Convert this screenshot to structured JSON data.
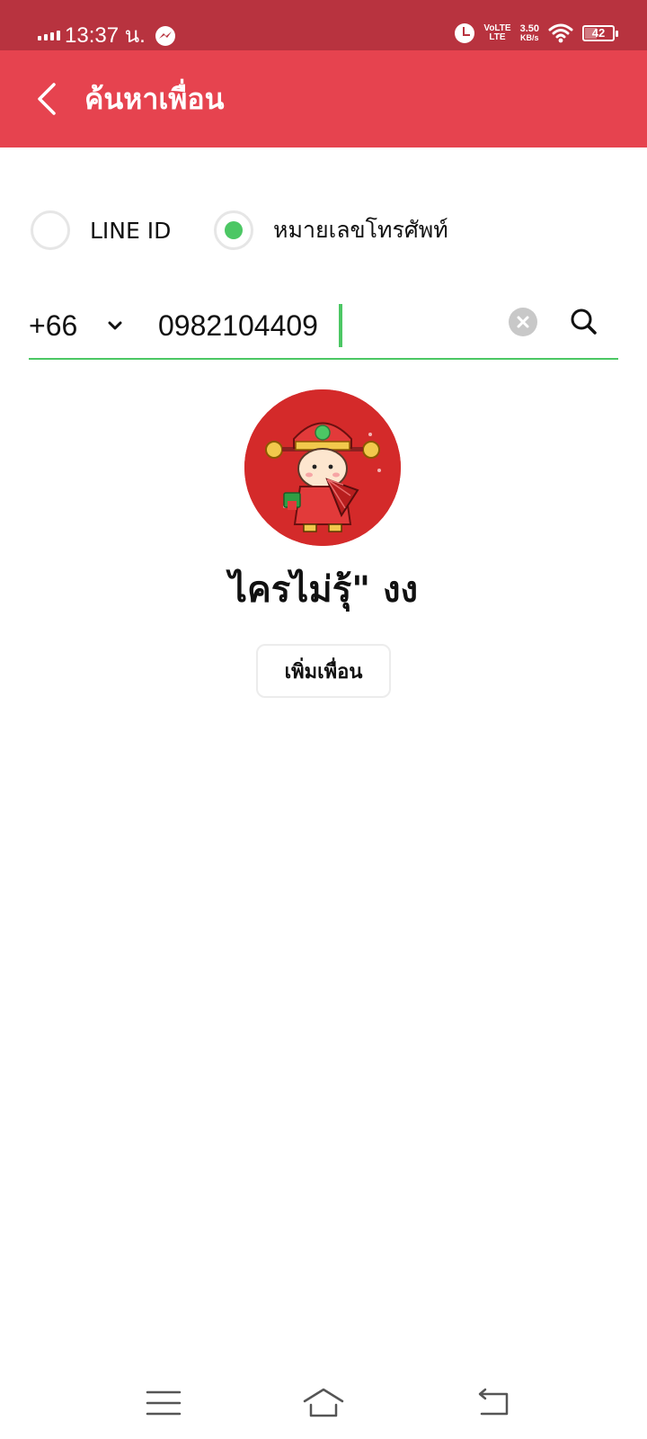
{
  "status_bar": {
    "time": "13:37 น.",
    "lte_line1": "VoLTE",
    "lte_line2": "LTE",
    "speed_value": "3.50",
    "speed_unit": "KB/s",
    "battery": "42",
    "battery_level_percent": 42
  },
  "header": {
    "title": "ค้นหาเพื่อน"
  },
  "search_type": {
    "options": [
      {
        "label": "LINE ID",
        "selected": false
      },
      {
        "label": "หมายเลขโทรศัพท์",
        "selected": true
      }
    ]
  },
  "search": {
    "country_code": "+66",
    "phone_value": "0982104409"
  },
  "result": {
    "name": "ไครไม่รุ้\" งง",
    "add_button_label": "เพิ่มเพื่อน"
  },
  "colors": {
    "status_bar": "#b8333f",
    "header": "#e6434f",
    "accent_green": "#4cc764"
  },
  "icons": [
    "back-arrow-icon",
    "chevron-down-icon",
    "clear-icon",
    "search-icon",
    "alarm-icon",
    "wifi-icon",
    "messenger-icon",
    "menu-icon",
    "home-icon",
    "back-nav-icon"
  ]
}
